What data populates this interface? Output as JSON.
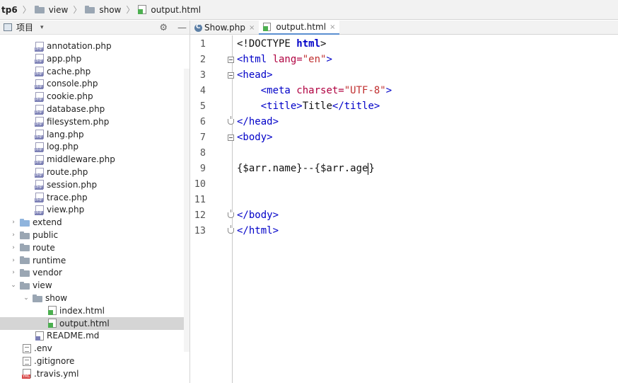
{
  "breadcrumb": {
    "root": "tp6",
    "items": [
      "view",
      "show",
      "output.html"
    ]
  },
  "project": {
    "title": "项目",
    "dropdown": "▾",
    "settings_icon": "gear-icon",
    "collapse_icon": "minus-icon"
  },
  "tree": [
    {
      "label": "annotation.php",
      "type": "php",
      "depth": 2
    },
    {
      "label": "app.php",
      "type": "php",
      "depth": 2
    },
    {
      "label": "cache.php",
      "type": "php",
      "depth": 2
    },
    {
      "label": "console.php",
      "type": "php",
      "depth": 2
    },
    {
      "label": "cookie.php",
      "type": "php",
      "depth": 2
    },
    {
      "label": "database.php",
      "type": "php",
      "depth": 2
    },
    {
      "label": "filesystem.php",
      "type": "php",
      "depth": 2
    },
    {
      "label": "lang.php",
      "type": "php",
      "depth": 2
    },
    {
      "label": "log.php",
      "type": "php",
      "depth": 2
    },
    {
      "label": "middleware.php",
      "type": "php",
      "depth": 2
    },
    {
      "label": "route.php",
      "type": "php",
      "depth": 2
    },
    {
      "label": "session.php",
      "type": "php",
      "depth": 2
    },
    {
      "label": "trace.php",
      "type": "php",
      "depth": 2
    },
    {
      "label": "view.php",
      "type": "php",
      "depth": 2
    },
    {
      "label": "extend",
      "type": "folder-blue",
      "depth": 1,
      "arrow": "closed"
    },
    {
      "label": "public",
      "type": "folder",
      "depth": 1,
      "arrow": "closed"
    },
    {
      "label": "route",
      "type": "folder",
      "depth": 1,
      "arrow": "closed"
    },
    {
      "label": "runtime",
      "type": "folder",
      "depth": 1,
      "arrow": "closed"
    },
    {
      "label": "vendor",
      "type": "folder",
      "depth": 1,
      "arrow": "closed"
    },
    {
      "label": "view",
      "type": "folder",
      "depth": 1,
      "arrow": "open"
    },
    {
      "label": "show",
      "type": "folder",
      "depth": 2,
      "arrow": "open"
    },
    {
      "label": "index.html",
      "type": "html",
      "depth": 3
    },
    {
      "label": "output.html",
      "type": "html",
      "depth": 3,
      "selected": true
    },
    {
      "label": "README.md",
      "type": "md",
      "depth": 2
    },
    {
      "label": ".env",
      "type": "txt",
      "depth": 1
    },
    {
      "label": ".gitignore",
      "type": "txt",
      "depth": 1
    },
    {
      "label": ".travis.yml",
      "type": "yml",
      "depth": 1
    }
  ],
  "tabs": [
    {
      "label": "Show.php",
      "active": false,
      "close": "×"
    },
    {
      "label": "output.html",
      "active": true,
      "close": "×"
    }
  ],
  "editor": {
    "line_numbers": [
      "1",
      "2",
      "3",
      "4",
      "5",
      "6",
      "7",
      "8",
      "9",
      "10",
      "11",
      "12",
      "13"
    ],
    "lines": [
      [
        {
          "t": "<!DOCTYPE ",
          "c": ""
        },
        {
          "t": "html",
          "c": "kw"
        },
        {
          "t": ">",
          "c": ""
        }
      ],
      [
        {
          "t": "<html ",
          "c": "tag"
        },
        {
          "t": "lang=",
          "c": "attr"
        },
        {
          "t": "\"en\"",
          "c": "str"
        },
        {
          "t": ">",
          "c": "tag"
        }
      ],
      [
        {
          "t": "<head>",
          "c": "tag"
        }
      ],
      [
        {
          "t": "    ",
          "c": ""
        },
        {
          "t": "<meta ",
          "c": "tag"
        },
        {
          "t": "charset=",
          "c": "attr"
        },
        {
          "t": "\"UTF-8\"",
          "c": "str"
        },
        {
          "t": ">",
          "c": "tag"
        }
      ],
      [
        {
          "t": "    ",
          "c": ""
        },
        {
          "t": "<title>",
          "c": "tag"
        },
        {
          "t": "Title",
          "c": ""
        },
        {
          "t": "</title>",
          "c": "tag"
        }
      ],
      [
        {
          "t": "</head>",
          "c": "tag"
        }
      ],
      [
        {
          "t": "<body>",
          "c": "tag"
        }
      ],
      [],
      [
        {
          "t": "{$arr.name}--{$arr.age",
          "c": ""
        },
        {
          "t": "CARET",
          "c": "caret"
        },
        {
          "t": "}",
          "c": ""
        }
      ],
      [],
      [],
      [
        {
          "t": "</body>",
          "c": "tag"
        }
      ],
      [
        {
          "t": "</html>",
          "c": "tag"
        }
      ]
    ],
    "folds": [
      {
        "line": 2,
        "kind": "open"
      },
      {
        "line": 3,
        "kind": "open"
      },
      {
        "line": 6,
        "kind": "end"
      },
      {
        "line": 7,
        "kind": "open"
      },
      {
        "line": 12,
        "kind": "end"
      },
      {
        "line": 13,
        "kind": "end"
      }
    ]
  },
  "colors": {
    "tag": "#0000c8",
    "attr": "#b00040",
    "string": "#c03030",
    "selection": "#d5d5d5",
    "active_tab_underline": "#5a8fd0"
  }
}
